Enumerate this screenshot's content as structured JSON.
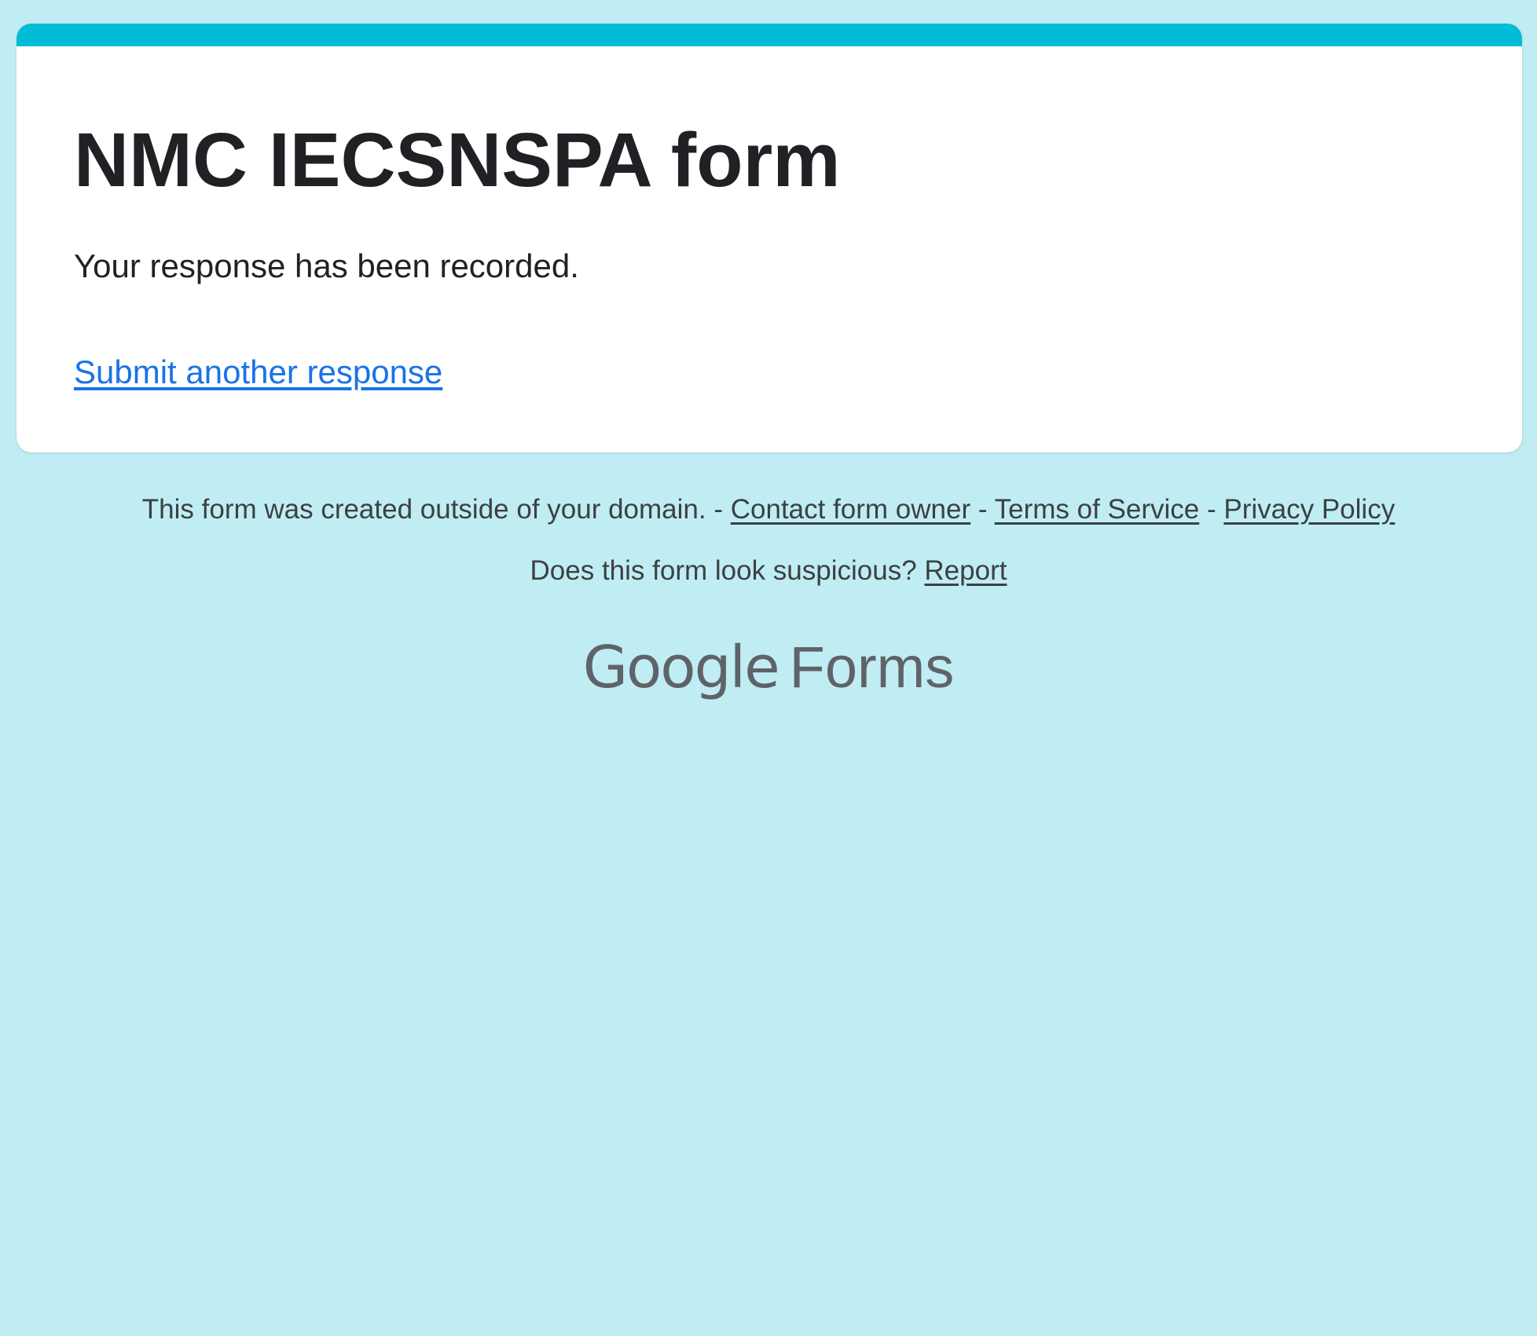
{
  "form": {
    "title": "NMC IECSNSPA form",
    "confirmation_message": "Your response has been recorded.",
    "submit_another_label": "Submit another response"
  },
  "footer": {
    "domain_notice": "This form was created outside of your domain.",
    "separator": "-",
    "contact_owner_label": "Contact form owner",
    "terms_label": "Terms of Service",
    "privacy_label": "Privacy Policy",
    "suspicious_prompt": "Does this form look suspicious?",
    "report_label": "Report"
  },
  "branding": {
    "google": "Google",
    "forms": "Forms"
  },
  "colors": {
    "background": "#bfedf3",
    "accent": "#00bcd4",
    "link": "#1a73e8",
    "text": "#202124",
    "footer_text": "#3c4043",
    "brand_text": "#5f6368"
  }
}
